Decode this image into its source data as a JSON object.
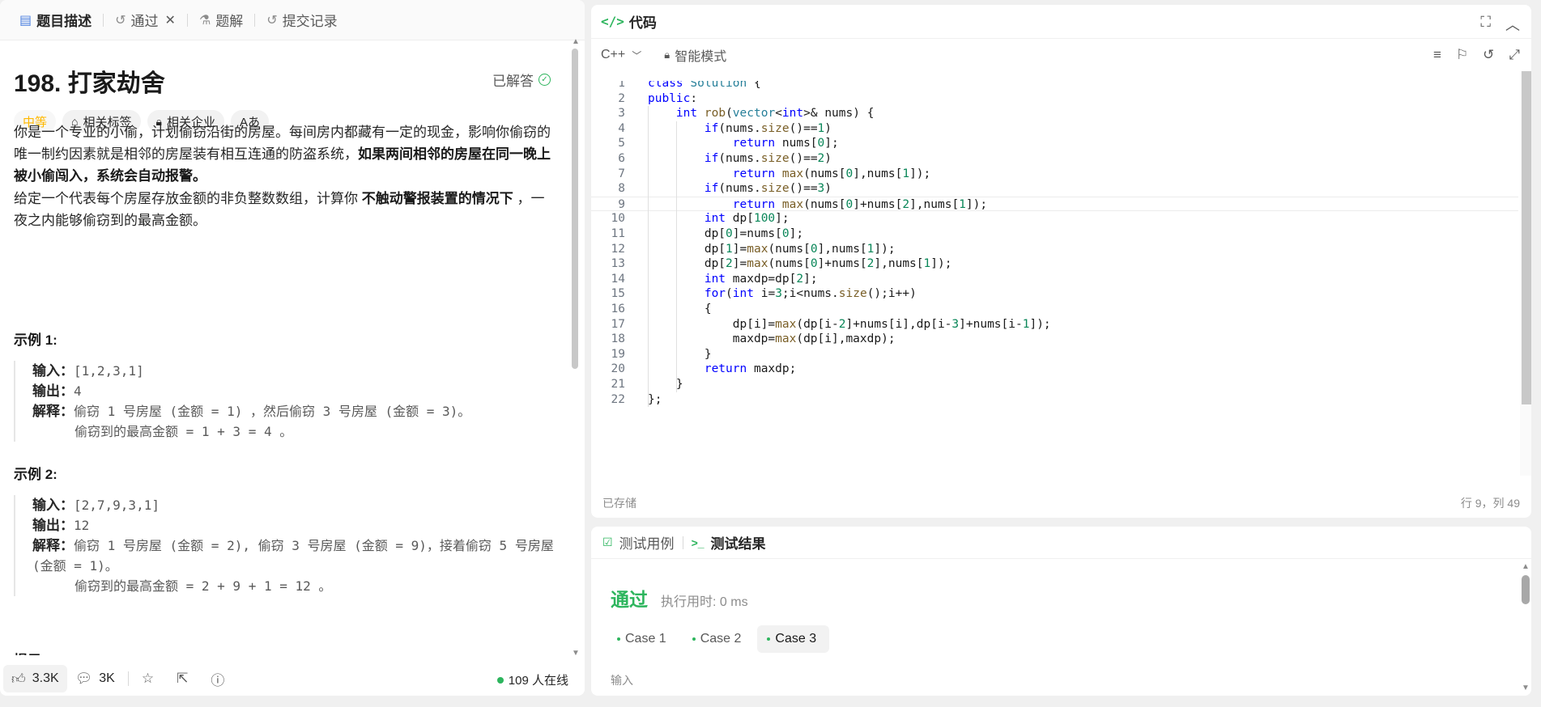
{
  "left_tabs": [
    {
      "label": "题目描述",
      "icon": "document-icon"
    },
    {
      "label": "通过",
      "icon": "history-icon"
    },
    {
      "label": "题解",
      "icon": "flask-icon"
    },
    {
      "label": "提交记录",
      "icon": "history-icon"
    }
  ],
  "problem": {
    "title": "198. 打家劫舍",
    "status": "已解答",
    "tags": {
      "difficulty": "中等",
      "related_tags": "相关标签",
      "related_companies": "相关企业",
      "font": "Aあ"
    },
    "desc1_a": "你是一个专业的小偷，计划偷窃沿街的房屋。每间房内都藏有一定的现金，影响你偷窃的唯一制约因素就是相邻的房屋装有相互连通的防盗系统，",
    "desc1_b": "如果两间相邻的房屋在同一晚上被小偷闯入，系统会自动报警",
    "desc1_c": "。",
    "desc2_a": "给定一个代表每个房屋存放金额的非负整数数组，计算你 ",
    "desc2_b": "不触动警报装置的情况下",
    "desc2_c": " ，一夜之内能够偷窃到的最高金额。"
  },
  "examples": [
    {
      "title": "示例 1:",
      "input_label": "输入：",
      "input": "[1,2,3,1]",
      "output_label": "输出：",
      "output": "4",
      "explain_label": "解释：",
      "explain1": "偷窃 1 号房屋 (金额 = 1) ，然后偷窃 3 号房屋 (金额 = 3)。",
      "explain2": "偷窃到的最高金额 = 1 + 3 = 4 。"
    },
    {
      "title": "示例 2:",
      "input_label": "输入：",
      "input": "[2,7,9,3,1]",
      "output_label": "输出：",
      "output": "12",
      "explain_label": "解释：",
      "explain1": "偷窃 1 号房屋 (金额 = 2), 偷窃 3 号房屋 (金额 = 9)，接着偷窃 5 号房屋 (金额 = 1)。",
      "explain2": "偷窃到的最高金额 = 2 + 9 + 1 = 12 。"
    }
  ],
  "hint_partial": "提示：",
  "bottom_bar": {
    "likes": "3.3K",
    "comments": "3K",
    "online": "109 人在线"
  },
  "code_panel": {
    "title": "代码",
    "language": "C++",
    "mode": "智能模式",
    "saved": "已存储",
    "cursor": "行 9，列 49",
    "lines": [
      "class Solution {",
      "public:",
      "    int rob(vector<int>& nums) {",
      "        if(nums.size()==1)",
      "            return nums[0];",
      "        if(nums.size()==2)",
      "            return max(nums[0],nums[1]);",
      "        if(nums.size()==3)",
      "            return max(nums[0]+nums[2],nums[1]);",
      "        int dp[100];",
      "        dp[0]=nums[0];",
      "        dp[1]=max(nums[0],nums[1]);",
      "        dp[2]=max(nums[0]+nums[2],nums[1]);",
      "        int maxdp=dp[2];",
      "        for(int i=3;i<nums.size();i++)",
      "        {",
      "            dp[i]=max(dp[i-2]+nums[i],dp[i-3]+nums[i-1]);",
      "            maxdp=max(dp[i],maxdp);",
      "        }",
      "        return maxdp;",
      "    }",
      "};"
    ]
  },
  "test_panel": {
    "tab_cases": "测试用例",
    "tab_results": "测试结果",
    "status": "通过",
    "runtime": "执行用时: 0 ms",
    "cases": [
      "Case 1",
      "Case 2",
      "Case 3"
    ],
    "input_label": "输入"
  }
}
